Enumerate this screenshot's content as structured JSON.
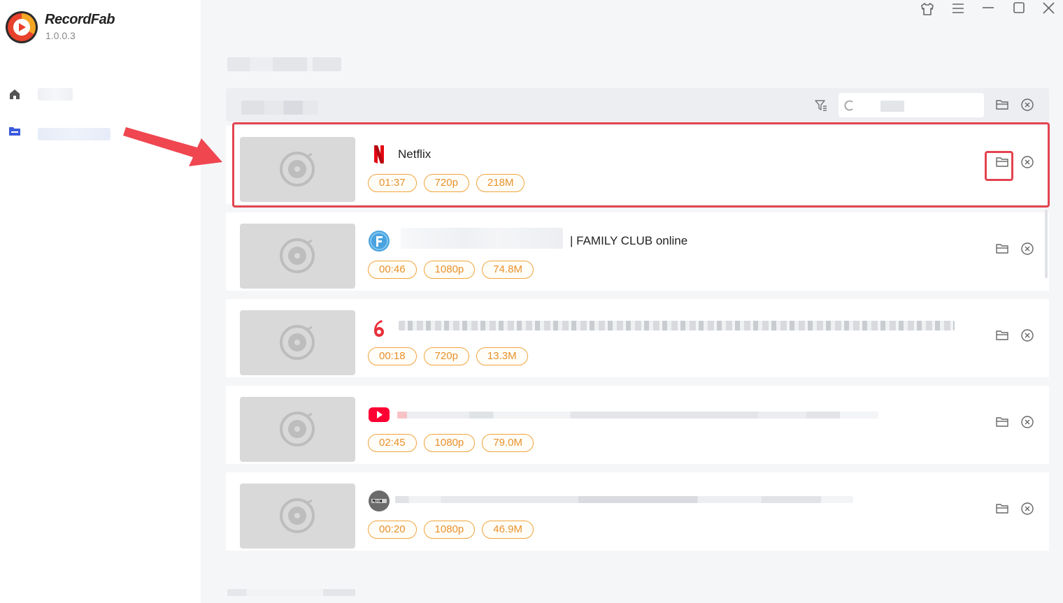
{
  "app": {
    "name": "RecordFab",
    "version": "1.0.0.3"
  },
  "search": {
    "value": "",
    "placeholder": ""
  },
  "colors": {
    "accent": "#e8912a",
    "tag_border": "#f0a43c",
    "highlight": "#e34450",
    "sidebar_active": "#3b5bdb"
  },
  "recordings": [
    {
      "site_icon": "netflix-icon",
      "title": "Netflix",
      "duration": "01:37",
      "resolution": "720p",
      "size": "218M"
    },
    {
      "site_icon": "family-club-icon",
      "title": "| FAMILY CLUB online",
      "duration": "00:46",
      "resolution": "1080p",
      "size": "74.8M"
    },
    {
      "site_icon": "channel-6-icon",
      "title": "",
      "duration": "00:18",
      "resolution": "720p",
      "size": "13.3M"
    },
    {
      "site_icon": "youtube-icon",
      "title": "",
      "duration": "02:45",
      "resolution": "1080p",
      "size": "79.0M"
    },
    {
      "site_icon": "nhk-icon",
      "title": "",
      "duration": "00:20",
      "resolution": "1080p",
      "size": "46.9M"
    }
  ]
}
